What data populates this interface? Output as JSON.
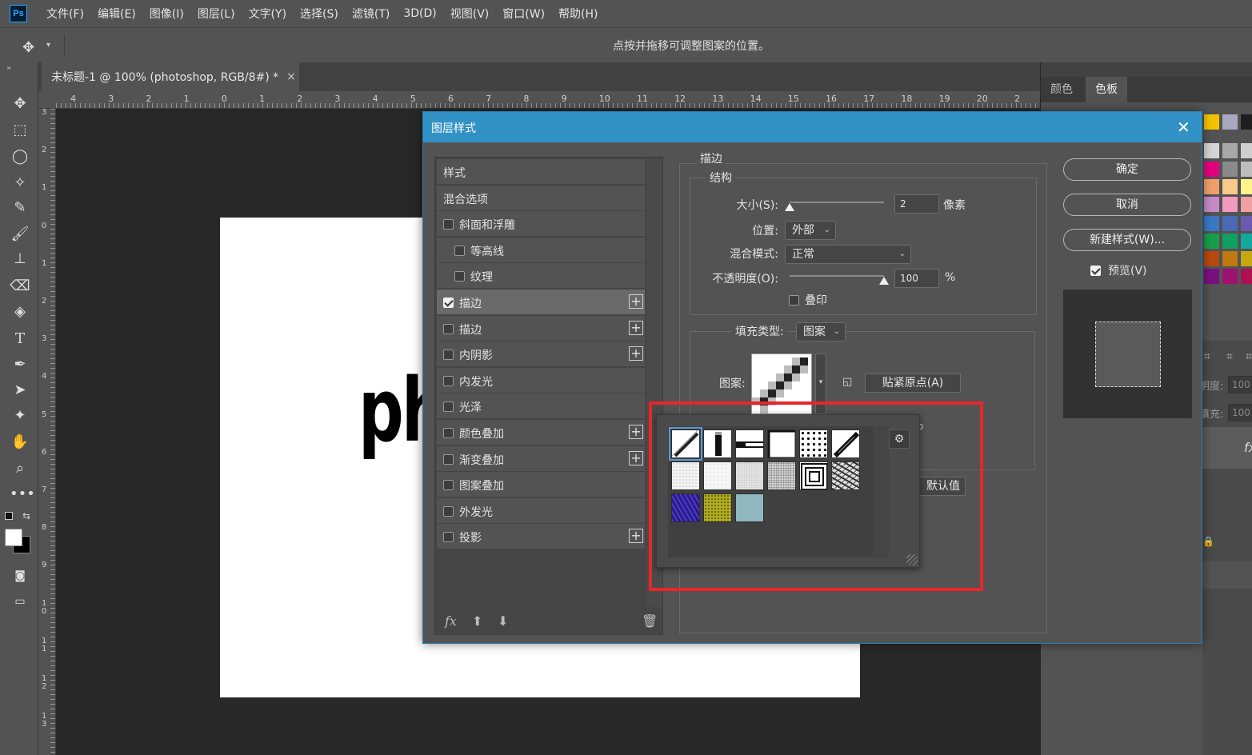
{
  "menu": [
    "文件(F)",
    "编辑(E)",
    "图像(I)",
    "图层(L)",
    "文字(Y)",
    "选择(S)",
    "滤镜(T)",
    "3D(D)",
    "视图(V)",
    "窗口(W)",
    "帮助(H)"
  ],
  "app_logo": "Ps",
  "options_hint": "点按并拖移可调整图案的位置。",
  "doc_tab": "未标题-1 @ 100% (photoshop, RGB/8#) *",
  "doc_tab_close": "×",
  "canvas_text": "ph",
  "ruler_top_labels": [
    "4",
    "3",
    "2",
    "1",
    "0",
    "1",
    "2",
    "3",
    "4",
    "5",
    "6",
    "7",
    "8",
    "9",
    "10",
    "11",
    "12",
    "13",
    "14",
    "15",
    "16",
    "17",
    "18",
    "19",
    "20",
    "2"
  ],
  "ruler_left_labels": [
    "3",
    "2",
    "1",
    "0",
    "1",
    "2",
    "3",
    "4",
    "5",
    "6",
    "7",
    "8",
    "9",
    "1 0",
    "1 1",
    "1 2",
    "1 3"
  ],
  "panel_tabs": {
    "color": "颜色",
    "swatches": "色板"
  },
  "panel_lower": {
    "opacity_label": "明度:",
    "opacity_value": "100",
    "fill_label": "填充:",
    "fill_value": "100",
    "fx": "fx"
  },
  "dialog": {
    "title": "图层样式",
    "close": "✕",
    "style_list": [
      {
        "label": "样式",
        "type": "header"
      },
      {
        "label": "混合选项",
        "type": "header"
      },
      {
        "label": "斜面和浮雕",
        "type": "check",
        "checked": false,
        "plus": false,
        "indent": false
      },
      {
        "label": "等高线",
        "type": "check",
        "checked": false,
        "plus": false,
        "indent": true
      },
      {
        "label": "纹理",
        "type": "check",
        "checked": false,
        "plus": false,
        "indent": true
      },
      {
        "label": "描边",
        "type": "check",
        "checked": true,
        "plus": true,
        "indent": false,
        "active": true
      },
      {
        "label": "描边",
        "type": "check",
        "checked": false,
        "plus": true,
        "indent": false
      },
      {
        "label": "内阴影",
        "type": "check",
        "checked": false,
        "plus": true,
        "indent": false
      },
      {
        "label": "内发光",
        "type": "check",
        "checked": false,
        "plus": false,
        "indent": false
      },
      {
        "label": "光泽",
        "type": "check",
        "checked": false,
        "plus": false,
        "indent": false
      },
      {
        "label": "颜色叠加",
        "type": "check",
        "checked": false,
        "plus": true,
        "indent": false
      },
      {
        "label": "渐变叠加",
        "type": "check",
        "checked": false,
        "plus": true,
        "indent": false
      },
      {
        "label": "图案叠加",
        "type": "check",
        "checked": false,
        "plus": false,
        "indent": false
      },
      {
        "label": "外发光",
        "type": "check",
        "checked": false,
        "plus": false,
        "indent": false
      },
      {
        "label": "投影",
        "type": "check",
        "checked": false,
        "plus": true,
        "indent": false
      }
    ],
    "footer_fx": "fx",
    "stroke": {
      "group_title": "描边",
      "structure_title": "结构",
      "size_label": "大小(S):",
      "size_value": "2",
      "size_unit": "像素",
      "size_fraction": 0.0,
      "position_label": "位置:",
      "position_value": "外部",
      "blend_label": "混合模式:",
      "blend_value": "正常",
      "opacity_label": "不透明度(O):",
      "opacity_value": "100",
      "opacity_unit": "%",
      "opacity_fraction": 1.0,
      "overprint_label": "叠印",
      "fill_type_label": "填充类型:",
      "fill_type_value": "图案",
      "pattern_label": "图案:",
      "snap_origin_button": "贴紧原点(A)",
      "partial_text_right": "o",
      "reset_default_partial": "默认值"
    },
    "buttons": {
      "ok": "确定",
      "cancel": "取消",
      "new_style": "新建样式(W)...",
      "preview_label": "预览(V)"
    },
    "preview_checked": true
  },
  "highlight_color": "#e8262a",
  "accent_color": "#3392c5"
}
